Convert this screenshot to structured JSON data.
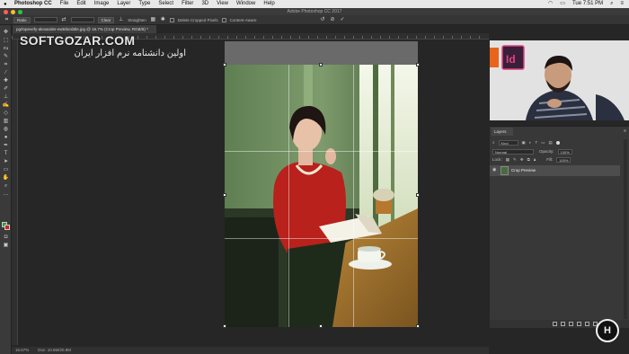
{
  "menubar": {
    "app_name": "Photoshop CC",
    "items": [
      "File",
      "Edit",
      "Image",
      "Layer",
      "Type",
      "Select",
      "Filter",
      "3D",
      "View",
      "Window",
      "Help"
    ],
    "clock": "Tue 7:51 PM"
  },
  "window": {
    "title": "Adobe Photoshop CC 2017"
  },
  "options_bar": {
    "ratio_label": "Ratio",
    "clear_label": "Clear",
    "straighten_label": "Straighten",
    "delete_cropped_label": "Delete Cropped Pixels",
    "content_aware_label": "Content-Aware"
  },
  "document": {
    "tab_label": "pgrlopevefy-alexander-ewtnbcsbtle.jpg @ 16.7% (Crop Preview, RGB/8) *"
  },
  "watermark": {
    "title": "SOFTGOZAR.COM",
    "subtitle": "اولین دانشنامه نرم افزار ایران"
  },
  "layers_panel": {
    "tab_label": "Layers",
    "kind_label": "Kind",
    "blend_mode": "Normal",
    "opacity_label": "Opacity:",
    "opacity_value": "100%",
    "fill_label": "Fill:",
    "fill_value": "100%",
    "layer_name": "Crop Preview"
  },
  "statusbar": {
    "zoom": "16.67%",
    "info": "Doc: 10.5M/20.9M"
  },
  "colors": {
    "background": "#262626",
    "panel": "#383838",
    "accent": "#2d7de0"
  }
}
